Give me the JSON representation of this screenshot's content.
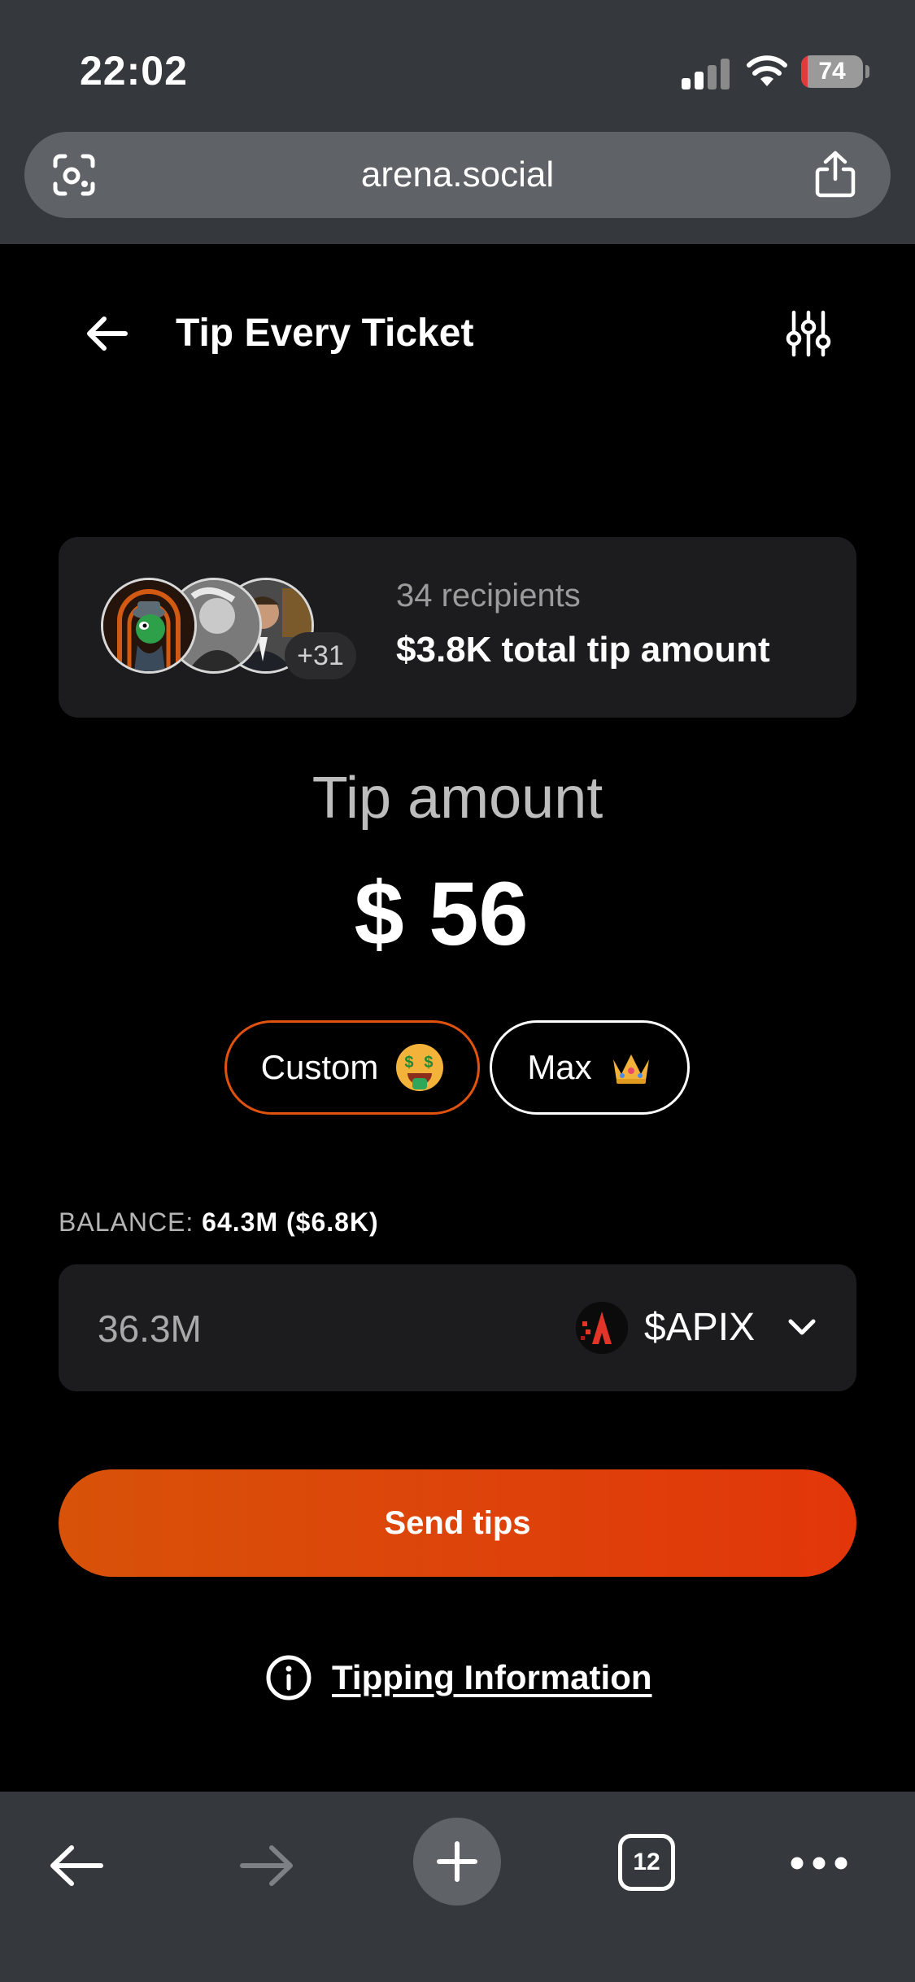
{
  "status_bar": {
    "time": "22:02",
    "battery": "74",
    "battery_level_percent": 10
  },
  "browser": {
    "url": "arena.social",
    "tab_count": "12"
  },
  "header": {
    "title": "Tip Every Ticket"
  },
  "recipients": {
    "count_text": "34 recipients",
    "total_text": "$3.8K total tip amount",
    "more_badge": "+31"
  },
  "tip": {
    "label": "Tip amount",
    "value": "$ 56"
  },
  "options": {
    "custom_label": "Custom",
    "max_label": "Max"
  },
  "balance": {
    "label": "BALANCE:",
    "value": "64.3M ($6.8K)"
  },
  "amount": {
    "value": "36.3M",
    "token": "$APIX"
  },
  "actions": {
    "send_label": "Send tips",
    "info_label": "Tipping Information"
  },
  "colors": {
    "accent": "#e2520f",
    "button_gradient_start": "#d85209",
    "button_gradient_end": "#e2360a",
    "card_bg": "#1c1c1e",
    "chrome_bg": "#35383c"
  }
}
